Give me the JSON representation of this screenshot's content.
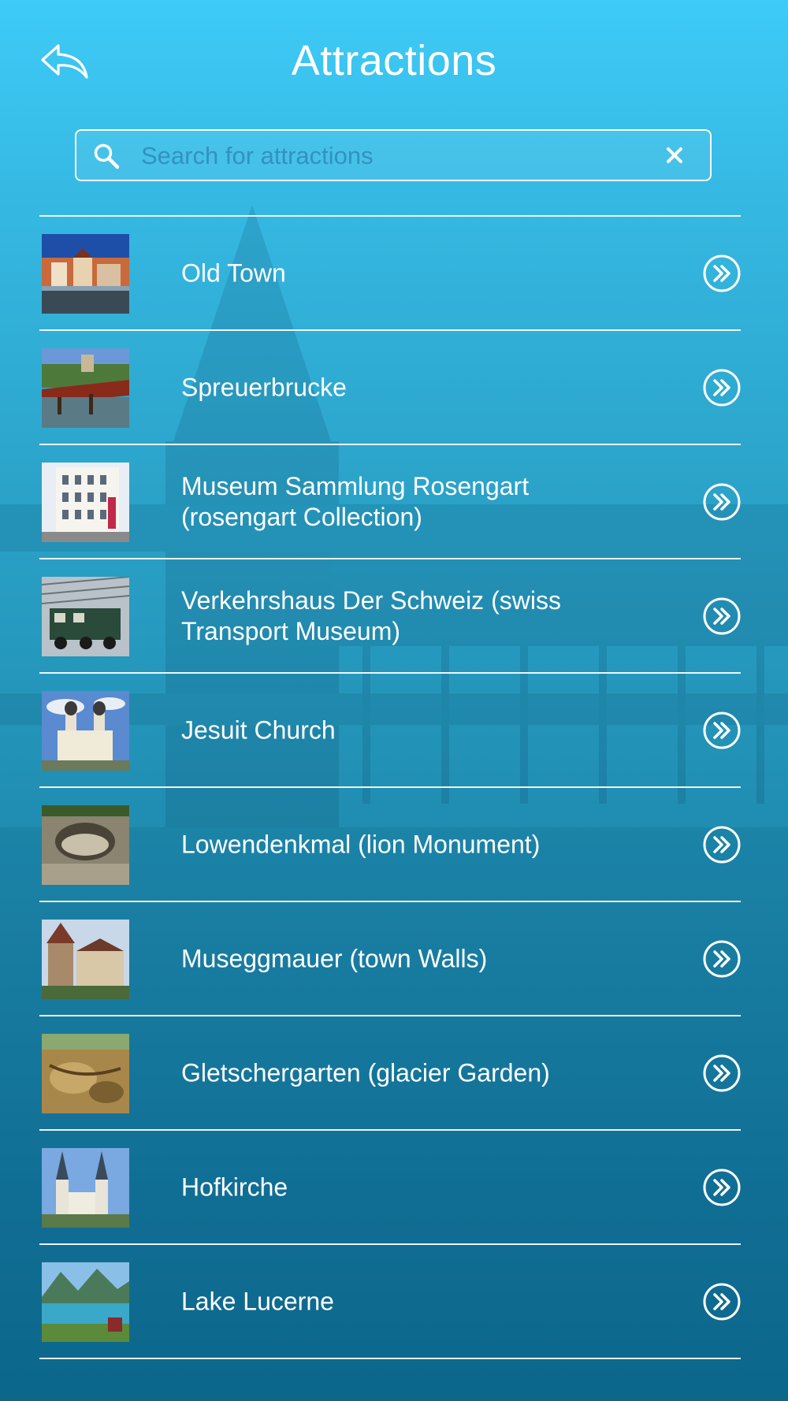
{
  "header": {
    "title": "Attractions"
  },
  "search": {
    "placeholder": "Search for attractions",
    "value": ""
  },
  "icons": {
    "back": "back-arrow-icon",
    "search": "search-icon",
    "clear": "clear-icon",
    "go": "double-chevron-right-circle-icon"
  },
  "attractions": [
    {
      "label": "Old Town"
    },
    {
      "label": "Spreuerbrucke"
    },
    {
      "label": "Museum Sammlung Rosengart (rosengart Collection)"
    },
    {
      "label": "Verkehrshaus Der Schweiz (swiss Transport Museum)"
    },
    {
      "label": "Jesuit Church"
    },
    {
      "label": "Lowendenkmal (lion Monument)"
    },
    {
      "label": "Museggmauer (town Walls)"
    },
    {
      "label": "Gletschergarten (glacier Garden)"
    },
    {
      "label": "Hofkirche"
    },
    {
      "label": "Lake Lucerne"
    }
  ],
  "colors": {
    "accent": "#3ecbf7",
    "background_bottom": "#0d6a8f",
    "text": "#ffffff"
  }
}
